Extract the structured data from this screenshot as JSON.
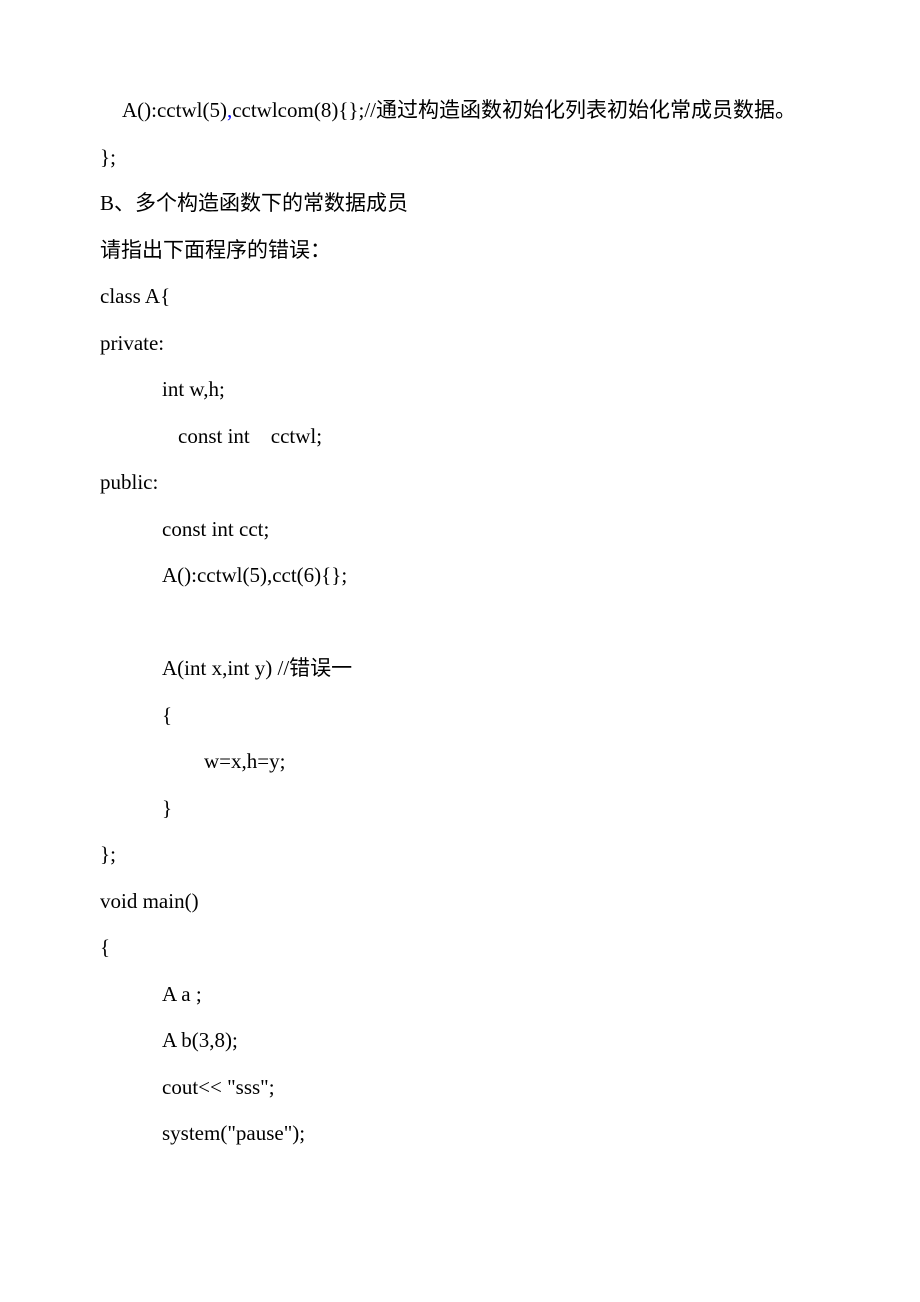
{
  "lines": {
    "l1a": "A():cctwl(5)",
    "l1b": ",",
    "l1c": "cctwlcom(8){};//通过构造函数初始化列表初始化常成员数据。",
    "l2": "};",
    "l3": "B、多个构造函数下的常数据成员",
    "l4": "请指出下面程序的错误：",
    "l5": "class A{",
    "l6": "private:",
    "l7": "int w,h;",
    "l8": "const int    cctwl;",
    "l9": "public:",
    "l10": "const int cct;",
    "l11": "A():cctwl(5),cct(6){};",
    "blank1": " ",
    "l12": "A(int x,int y) //错误一",
    "l13": "{",
    "l14": "w=x,h=y;",
    "l15": "}",
    "l16": "};",
    "l17": "void main()",
    "l18": "{",
    "l19": "A a ;",
    "l20": "A b(3,8);",
    "l21": "cout<< \"sss\";",
    "l22": "system(\"pause\");"
  }
}
